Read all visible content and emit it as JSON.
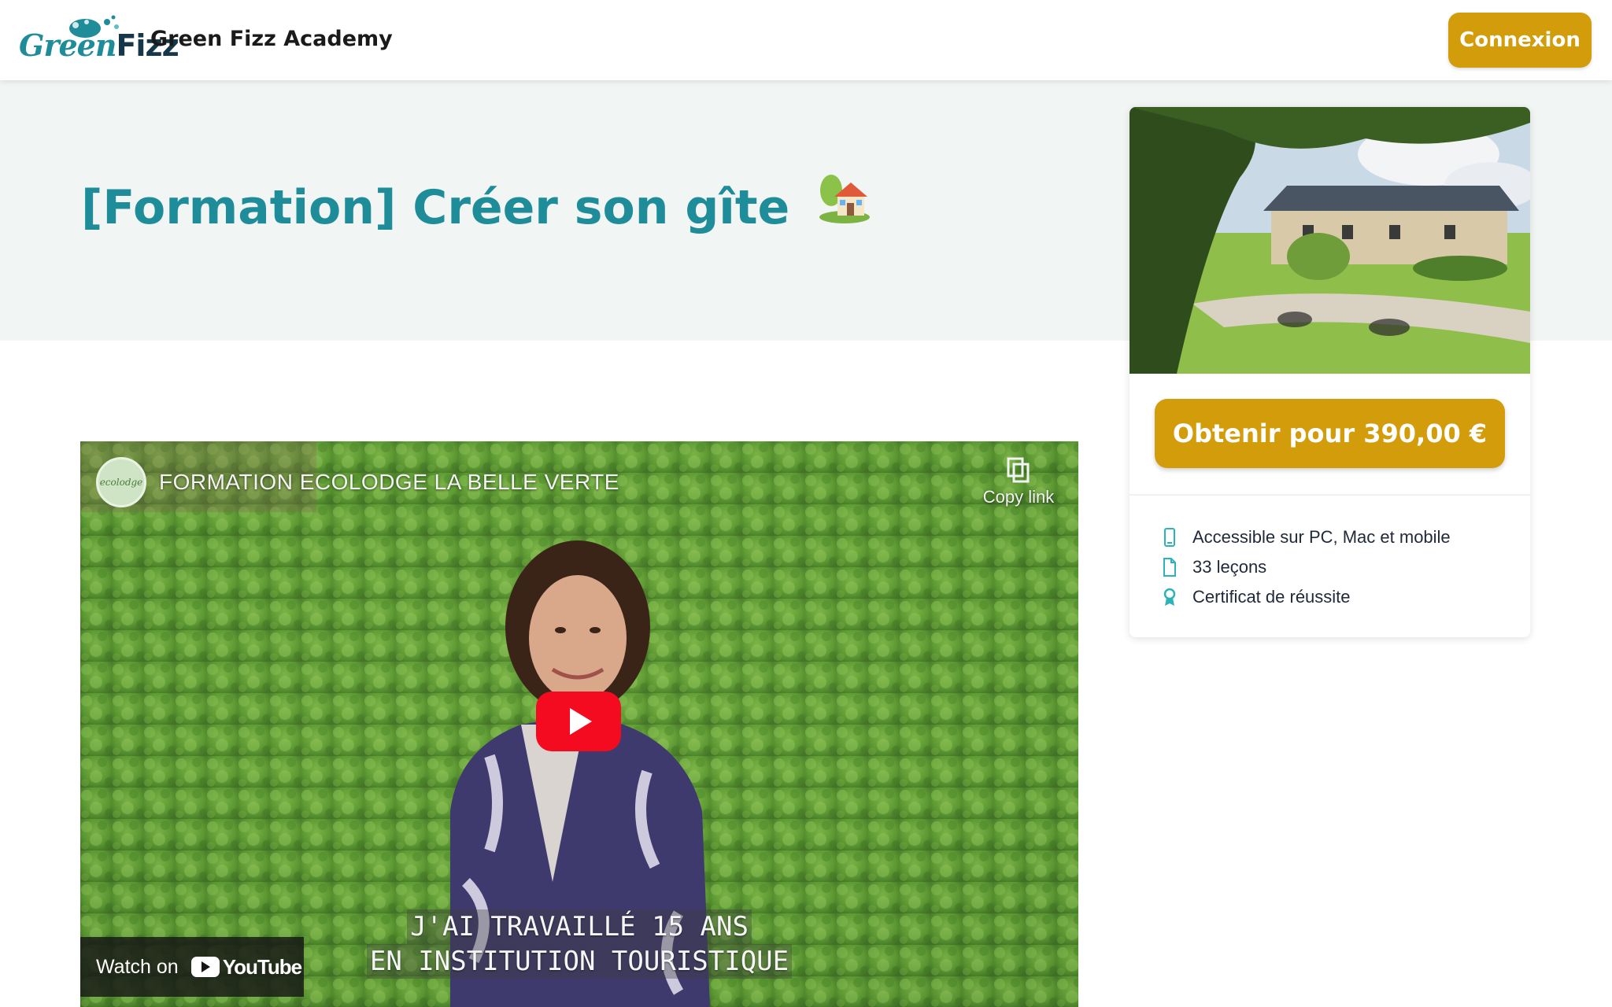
{
  "header": {
    "logo_green": "Green",
    "logo_fizz": "Fizz",
    "brand_name": "Green Fizz Academy",
    "login_label": "Connexion"
  },
  "course": {
    "title": "[Formation] Créer son gîte"
  },
  "video": {
    "channel_title": "FORMATION ECOLODGE LA BELLE VERTE",
    "copy_link_label": "Copy link",
    "watch_on_label": "Watch on",
    "youtube_label": "YouTube",
    "subtitle_line1": "J'AI TRAVAILLÉ 15 ANS",
    "subtitle_line2": "EN INSTITUTION TOURISTIQUE"
  },
  "card": {
    "buy_label": "Obtenir pour 390,00 €",
    "features": [
      {
        "icon": "mobile-icon",
        "label": "Accessible sur PC, Mac et mobile"
      },
      {
        "icon": "document-icon",
        "label": "33 leçons"
      },
      {
        "icon": "award-icon",
        "label": "Certificat de réussite"
      }
    ]
  },
  "colors": {
    "teal": "#1e8c99",
    "gold_button": "#d39c0a",
    "hero_bg": "#f1f5f4",
    "youtube_red": "#f40b1f"
  }
}
